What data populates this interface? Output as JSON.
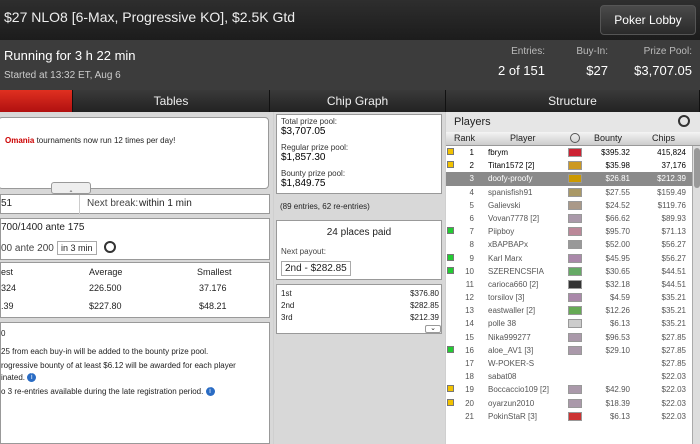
{
  "window": {
    "title": "$27 NLO8 [6-Max, Progressive KO], $2.5K Gtd"
  },
  "header": {
    "lobby_button": "Poker Lobby"
  },
  "info": {
    "running": "Running for 3 h 22 min",
    "started": "Started at 13:32 ET, Aug 6",
    "entries_label": "Entries:",
    "entries_value": "2 of 151",
    "buyin_label": "Buy-In:",
    "buyin_value": "$27",
    "prizepool_label": "Prize Pool:",
    "prizepool_value": "$3,707.05"
  },
  "tabs": [
    {
      "label": ""
    },
    {
      "label": "Tables"
    },
    {
      "label": "Chip Graph"
    },
    {
      "label": "Structure"
    }
  ],
  "promo": {
    "brand": "Omania",
    "text": " tournaments now run 12 times per day!"
  },
  "level": {
    "number": "51",
    "next_break_label": "Next break:",
    "next_break_value": "within 1 min"
  },
  "blinds": {
    "current": "700/1400 ante 175",
    "next": "00 ante 200",
    "next_in": "in 3 min"
  },
  "stacks": {
    "headers": [
      "est",
      "Average",
      "Smallest"
    ],
    "row1": [
      "324",
      "226.500",
      "37.176"
    ],
    "row2": [
      ".39",
      "$227.80",
      "$48.21"
    ]
  },
  "bounty": {
    "l1": "0",
    "l2": "25 from each buy-in will be added to the bounty prize pool.",
    "l3": "rogressive bounty of at least $6.12 will be awarded for each player",
    "l4": "inated.",
    "l5": "o 3 re-entries available during the late registration period."
  },
  "prizes": {
    "total_label": "Total prize pool:",
    "total_value": "$3,707.05",
    "regular_label": "Regular prize pool:",
    "regular_value": "$1,857.30",
    "bounty_label": "Bounty prize pool:",
    "bounty_value": "$1,849.75",
    "entries_note": "(89 entries, 62 re-entries)",
    "places_paid": "24 places paid",
    "next_payout_label": "Next payout:",
    "next_payout_value": "2nd - $282.85",
    "payouts": [
      {
        "place": "1st",
        "amount": "$376.80"
      },
      {
        "place": "2nd",
        "amount": "$282.85"
      },
      {
        "place": "3rd",
        "amount": "$212.39"
      }
    ]
  },
  "players": {
    "title": "Players",
    "columns": {
      "rank": "Rank",
      "player": "Player",
      "bounty": "Bounty",
      "chips": "Chips"
    },
    "rows": [
      {
        "rank": "1",
        "name": "fbrym",
        "bounty": "$395.32",
        "chips": "415,824",
        "marker": "#f2c200",
        "flag": "#c23"
      },
      {
        "rank": "2",
        "name": "Titan1572 [2]",
        "bounty": "$35.98",
        "chips": "37,176",
        "marker": "#f2c200",
        "flag": "#c92"
      },
      {
        "rank": "3",
        "name": "doofy-proofy",
        "bounty": "$26.81",
        "chips": "$212.39",
        "marker": "",
        "flag": "#c90"
      },
      {
        "rank": "4",
        "name": "spanisfish91",
        "bounty": "$27.55",
        "chips": "$159.49",
        "marker": "",
        "flag": "#a96"
      },
      {
        "rank": "5",
        "name": "Galievski",
        "bounty": "$24.52",
        "chips": "$119.76",
        "marker": "",
        "flag": "#a98"
      },
      {
        "rank": "6",
        "name": "Vovan7778 [2]",
        "bounty": "$66.62",
        "chips": "$89.93",
        "marker": "",
        "flag": "#a9a"
      },
      {
        "rank": "7",
        "name": "Piipboy",
        "bounty": "$95.70",
        "chips": "$71.13",
        "marker": "#2c3",
        "flag": "#b89"
      },
      {
        "rank": "8",
        "name": "xBAPBAPx",
        "bounty": "$52.00",
        "chips": "$56.27",
        "marker": "",
        "flag": "#999"
      },
      {
        "rank": "9",
        "name": "Karl Marx",
        "bounty": "$45.95",
        "chips": "$56.27",
        "marker": "#2c3",
        "flag": "#a8a"
      },
      {
        "rank": "10",
        "name": "SZERENCSFIA",
        "bounty": "$30.65",
        "chips": "$44.51",
        "marker": "#2c3",
        "flag": "#6a6"
      },
      {
        "rank": "11",
        "name": "carioca660 [2]",
        "bounty": "$32.18",
        "chips": "$44.51",
        "marker": "",
        "flag": "#333"
      },
      {
        "rank": "12",
        "name": "torsilov [3]",
        "bounty": "$4.59",
        "chips": "$35.21",
        "marker": "",
        "flag": "#a8a"
      },
      {
        "rank": "13",
        "name": "eastwaller [2]",
        "bounty": "$12.26",
        "chips": "$35.21",
        "marker": "",
        "flag": "#6a5"
      },
      {
        "rank": "14",
        "name": "polle 38",
        "bounty": "$6.13",
        "chips": "$35.21",
        "marker": "",
        "flag": "#ccc"
      },
      {
        "rank": "15",
        "name": "Nika999277",
        "bounty": "$96.53",
        "chips": "$27.85",
        "marker": "",
        "flag": "#a9a"
      },
      {
        "rank": "16",
        "name": "aloe_AV1 [3]",
        "bounty": "$29.10",
        "chips": "$27.85",
        "marker": "#2c3",
        "flag": "#a9a"
      },
      {
        "rank": "17",
        "name": "W-POKER-S",
        "bounty": "",
        "chips": "$27.85",
        "marker": "",
        "flag": ""
      },
      {
        "rank": "18",
        "name": "sabat08",
        "bounty": "",
        "chips": "$22.03",
        "marker": "",
        "flag": ""
      },
      {
        "rank": "19",
        "name": "Boccaccio109 [2]",
        "bounty": "$42.90",
        "chips": "$22.03",
        "marker": "#f2c200",
        "flag": "#a9a"
      },
      {
        "rank": "20",
        "name": "oyarzun2010",
        "bounty": "$18.39",
        "chips": "$22.03",
        "marker": "#f2c200",
        "flag": "#a9a"
      },
      {
        "rank": "21",
        "name": "PokinStaR [3]",
        "bounty": "$6.13",
        "chips": "$22.03",
        "marker": "",
        "flag": "#c33"
      }
    ]
  }
}
